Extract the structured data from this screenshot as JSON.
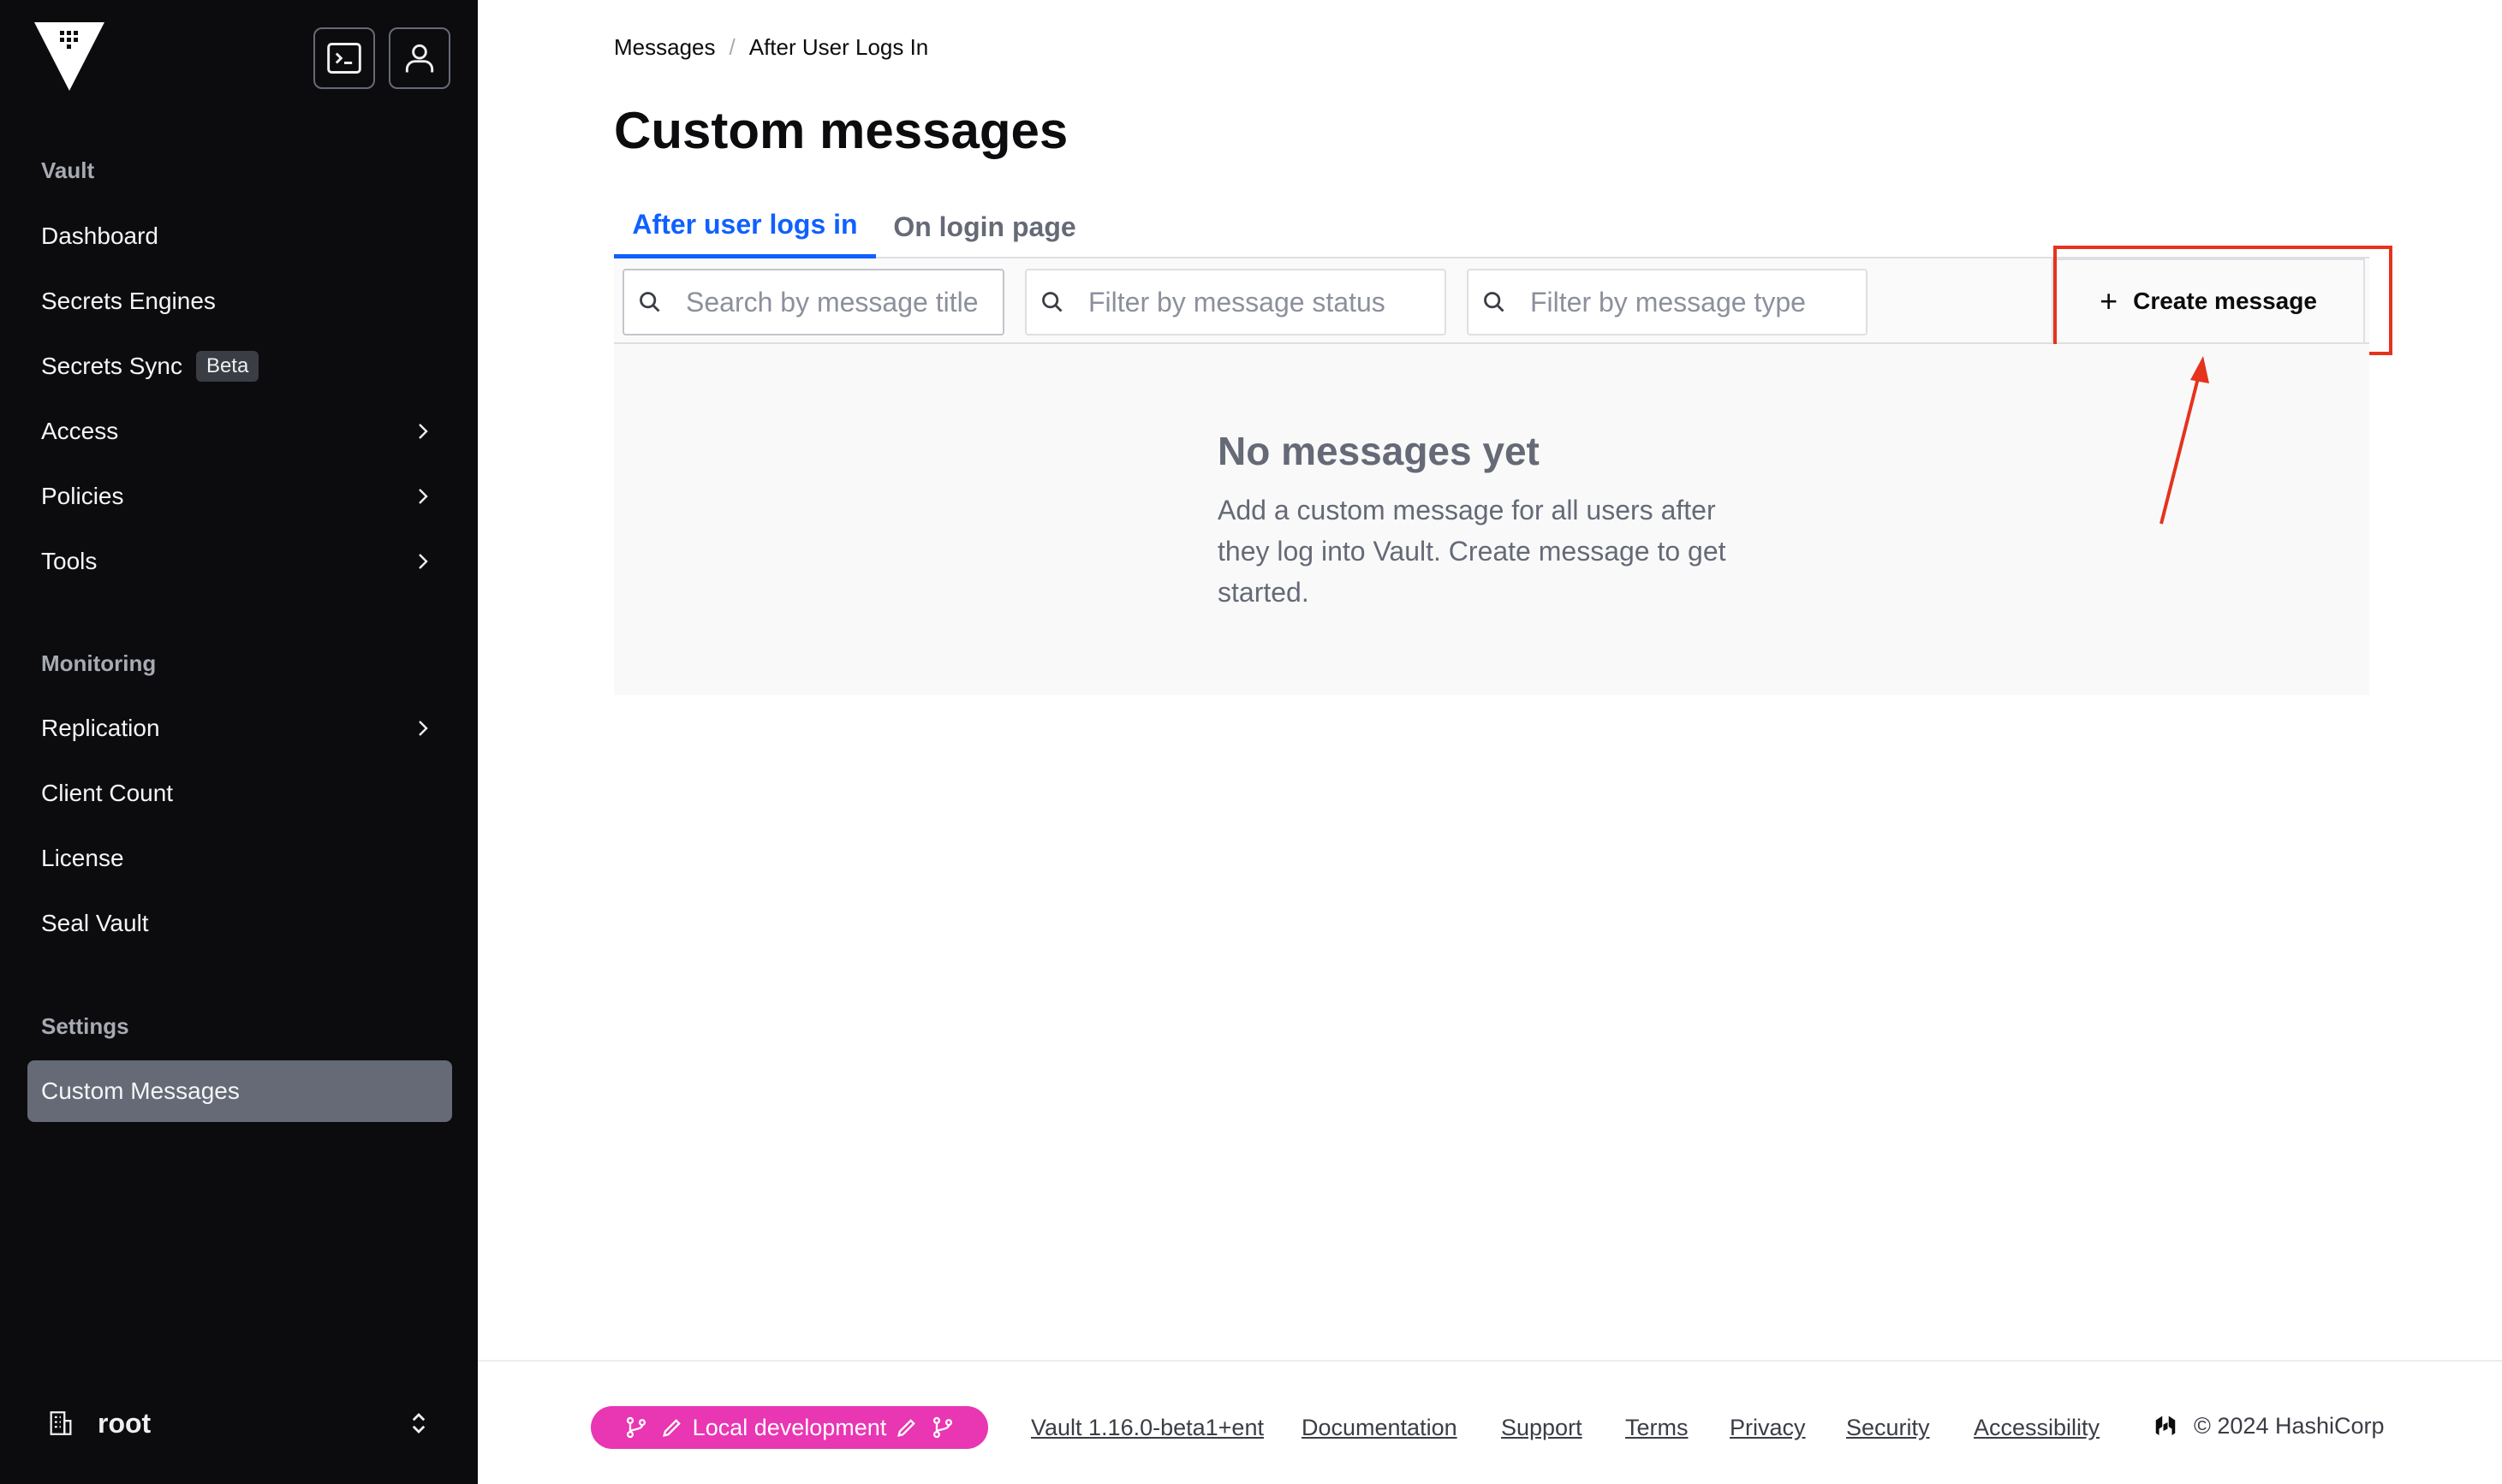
{
  "sidebar": {
    "sections": [
      {
        "title": "Vault",
        "items": [
          {
            "label": "Dashboard",
            "chevron": false
          },
          {
            "label": "Secrets Engines",
            "chevron": false
          },
          {
            "label": "Secrets Sync",
            "badge": "Beta",
            "chevron": false
          },
          {
            "label": "Access",
            "chevron": true
          },
          {
            "label": "Policies",
            "chevron": true
          },
          {
            "label": "Tools",
            "chevron": true
          }
        ]
      },
      {
        "title": "Monitoring",
        "items": [
          {
            "label": "Replication",
            "chevron": true
          },
          {
            "label": "Client Count",
            "chevron": false
          },
          {
            "label": "License",
            "chevron": false
          },
          {
            "label": "Seal Vault",
            "chevron": false
          }
        ]
      },
      {
        "title": "Settings",
        "items": [
          {
            "label": "Custom Messages",
            "active": true
          }
        ]
      }
    ],
    "namespace": "root",
    "top_buttons": [
      "terminal-icon",
      "user-icon"
    ]
  },
  "breadcrumb": {
    "items": [
      "Messages",
      "After User Logs In"
    ],
    "separator": "/"
  },
  "page": {
    "title": "Custom messages"
  },
  "tabs": [
    {
      "label": "After user logs in",
      "active": true
    },
    {
      "label": "On login page",
      "active": false
    }
  ],
  "filters": {
    "search_placeholder": "Search by message title",
    "status_placeholder": "Filter by message status",
    "type_placeholder": "Filter by message type"
  },
  "toolbar": {
    "create_label": "Create message",
    "create_icon": "plus-icon"
  },
  "empty_state": {
    "title": "No messages yet",
    "body": "Add a custom message for all users after they log into Vault. Create message to get started."
  },
  "footer": {
    "env_badge": "Local development",
    "version": "Vault 1.16.0-beta1+ent",
    "links": [
      "Documentation",
      "Support",
      "Terms",
      "Privacy",
      "Security",
      "Accessibility"
    ],
    "copyright": "© 2024 HashiCorp"
  },
  "colors": {
    "sidebar_bg": "#0c0c0e",
    "accent": "#1060ff",
    "annotation": "#e5331e",
    "env_badge": "#e936b3"
  }
}
